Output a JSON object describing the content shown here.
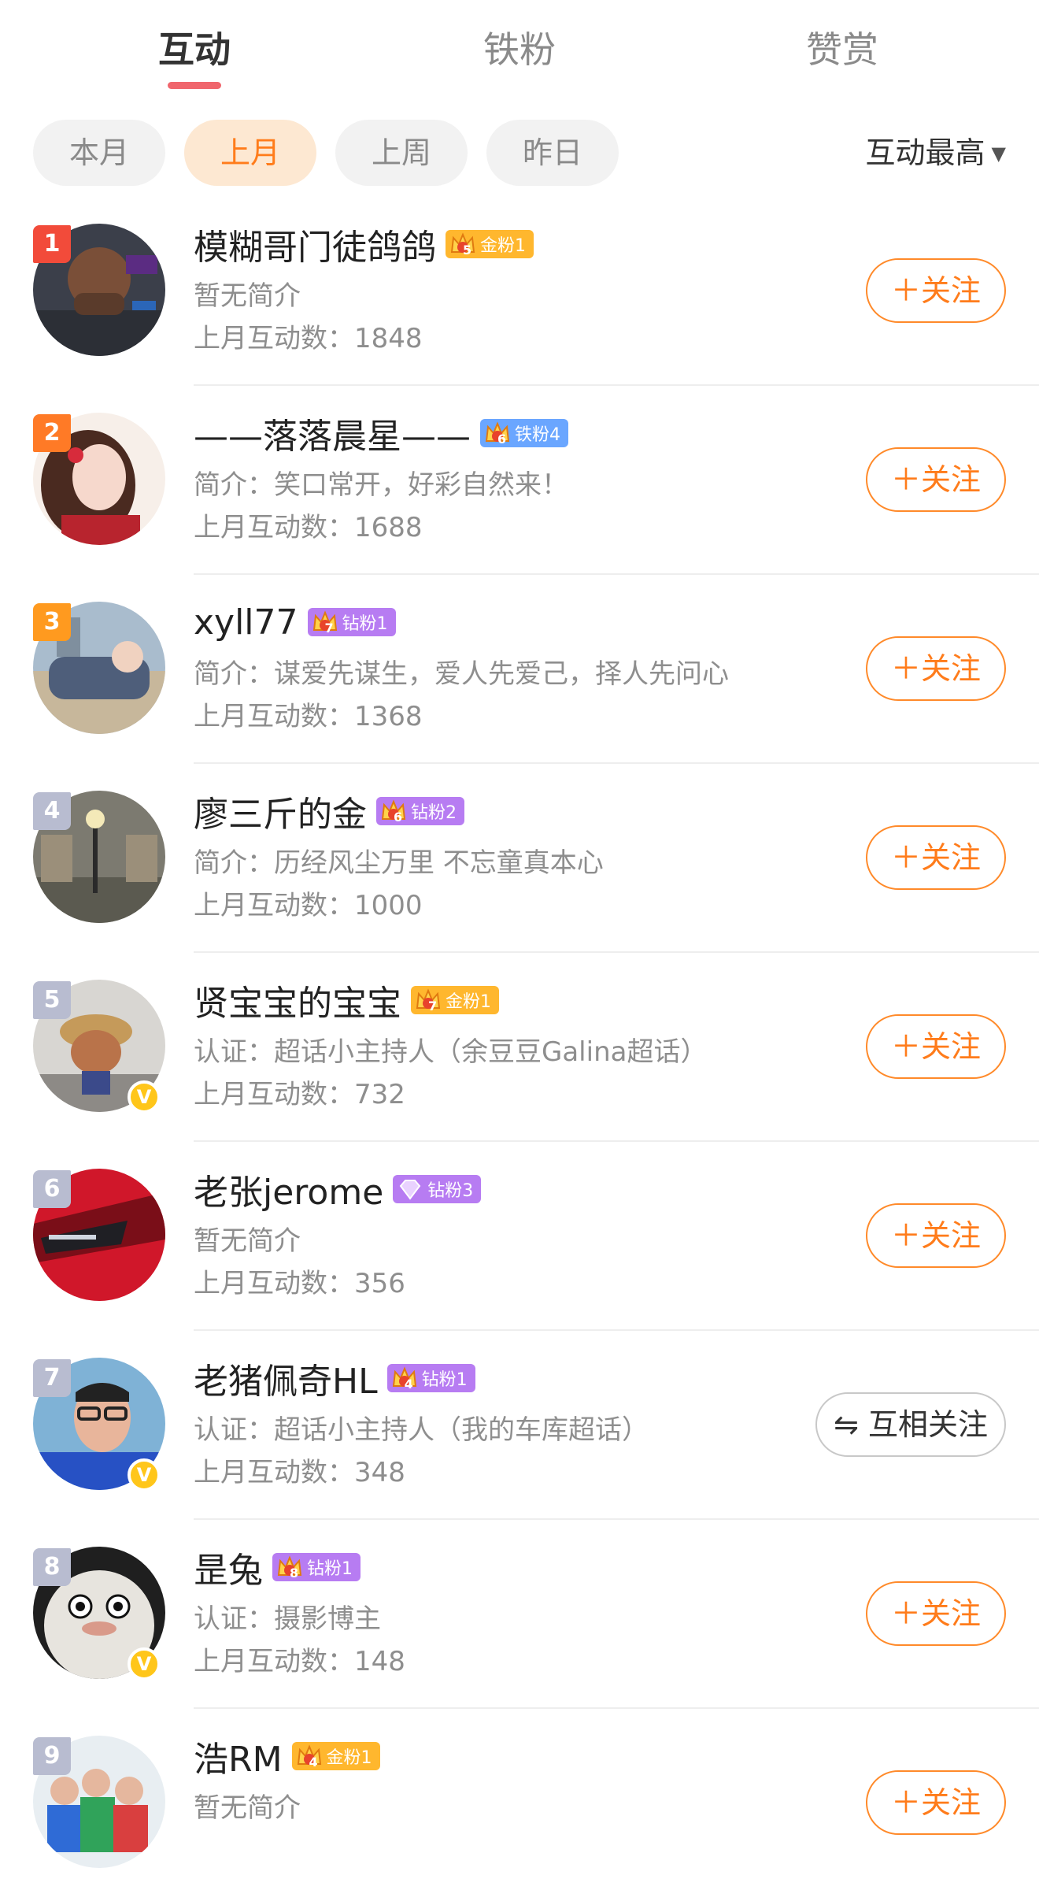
{
  "tabs": [
    {
      "label": "互动"
    },
    {
      "label": "铁粉"
    },
    {
      "label": "赞赏"
    }
  ],
  "filters": [
    {
      "label": "本月"
    },
    {
      "label": "上月"
    },
    {
      "label": "上周"
    },
    {
      "label": "昨日"
    }
  ],
  "sort": {
    "label": "互动最高"
  },
  "colors": {
    "accent": "#ff7c1b",
    "tab_underline": "#f0666d",
    "rank_red": "#f24b3a",
    "rank_orange": "#ff7a26",
    "rank_amber": "#ff9a1f",
    "rank_gray": "#b8bcd0",
    "badge_gold": "#ffb72e",
    "badge_iron": "#6aa6ff",
    "badge_diamond": "#b77cf2",
    "verified": "#ffc61a"
  },
  "users": [
    {
      "rank": "1",
      "name": "模糊哥门徒鸽鸽",
      "badge_level": "5",
      "badge_label": "金粉1",
      "intro": "暂无简介",
      "count": "上月互动数：1848",
      "follow": "＋关注"
    },
    {
      "rank": "2",
      "name": "——落落晨星——",
      "badge_level": "6",
      "badge_label": "铁粉4",
      "intro": "简介：笑口常开，好彩自然来！",
      "count": "上月互动数：1688",
      "follow": "＋关注"
    },
    {
      "rank": "3",
      "name": "xyll77",
      "badge_level": "7",
      "badge_label": "钻粉1",
      "intro": "简介：谋爱先谋生，爱人先爱己，择人先问心",
      "count": "上月互动数：1368",
      "follow": "＋关注"
    },
    {
      "rank": "4",
      "name": "廖三斤的金",
      "badge_level": "6",
      "badge_label": "钻粉2",
      "intro": "简介：历经风尘万里 不忘童真本心",
      "count": "上月互动数：1000",
      "follow": "＋关注"
    },
    {
      "rank": "5",
      "name": "贤宝宝的宝宝",
      "badge_level": "7",
      "badge_label": "金粉1",
      "intro": "认证：超话小主持人（余豆豆Galina超话）",
      "count": "上月互动数：732",
      "follow": "＋关注"
    },
    {
      "rank": "6",
      "name": "老张jerome",
      "badge_level": "",
      "badge_label": "钻粉3",
      "intro": "暂无简介",
      "count": "上月互动数：356",
      "follow": "＋关注"
    },
    {
      "rank": "7",
      "name": "老猪佩奇HL",
      "badge_level": "4",
      "badge_label": "钻粉1",
      "intro": "认证：超话小主持人（我的车库超话）",
      "count": "上月互动数：348",
      "follow": "⇋ 互相关注"
    },
    {
      "rank": "8",
      "name": "昰兔",
      "badge_level": "8",
      "badge_label": "钻粉1",
      "intro": "认证：摄影博主",
      "count": "上月互动数：148",
      "follow": "＋关注"
    },
    {
      "rank": "9",
      "name": "浩RM",
      "badge_level": "4",
      "badge_label": "金粉1",
      "intro": "暂无简介",
      "count": "",
      "follow": "＋关注"
    }
  ]
}
